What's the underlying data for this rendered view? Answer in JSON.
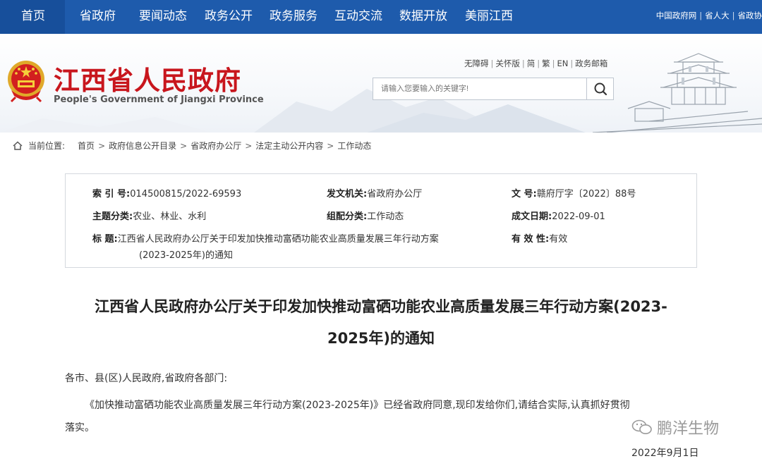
{
  "nav": {
    "items": [
      "首页",
      "省政府",
      "要闻动态",
      "政务公开",
      "政务服务",
      "互动交流",
      "数据开放",
      "美丽江西"
    ],
    "links": [
      "中国政府网",
      "省人大",
      "省政协"
    ],
    "bg_color": "#1e5bac"
  },
  "header": {
    "title": "江西省人民政府",
    "subtitle": "People's Government of Jiangxi Province",
    "utility_links": [
      "无障碍",
      "关怀版",
      "简",
      "繁",
      "EN",
      "政务邮箱"
    ],
    "search_placeholder": "请输入您要输入的关键字!",
    "title_color": "#c8161d"
  },
  "breadcrumb": {
    "label": "当前位置:",
    "items": [
      "首页",
      "政府信息公开目录",
      "省政府办公厅",
      "法定主动公开内容",
      "工作动态"
    ]
  },
  "info": {
    "index_label": "索  引  号:",
    "index_value": "014500815/2022-69593",
    "issuer_label": "发文机关:",
    "issuer_value": "省政府办公厅",
    "docno_label": "文      号:",
    "docno_value": "赣府厅字〔2022〕88号",
    "topic_label": "主题分类:",
    "topic_value": "农业、林业、水利",
    "category_label": "组配分类:",
    "category_value": "工作动态",
    "date_label": "成文日期:",
    "date_value": "2022-09-01",
    "subject_label": "标      题:",
    "subject_line1": "江西省人民政府办公厅关于印发加快推动富硒功能农业高质量发展三年行动方案",
    "subject_line2": "(2023-2025年)的通知",
    "validity_label": "有  效  性:",
    "validity_value": "有效"
  },
  "article": {
    "title_line1": "江西省人民政府办公厅关于印发加快推动富硒功能农业高质量发展三年行动方案(2023-",
    "title_line2": "2025年)的通知",
    "salutation": "各市、县(区)人民政府,省政府各部门:",
    "body_line1": "《加快推动富硒功能农业高质量发展三年行动方案(2023-2025年)》已经省政府同意,现印发给你们,请结合实际,认真抓好贯彻",
    "body_line2": "落实。",
    "date": "2022年9月1日"
  },
  "watermark": "鹏洋生物"
}
